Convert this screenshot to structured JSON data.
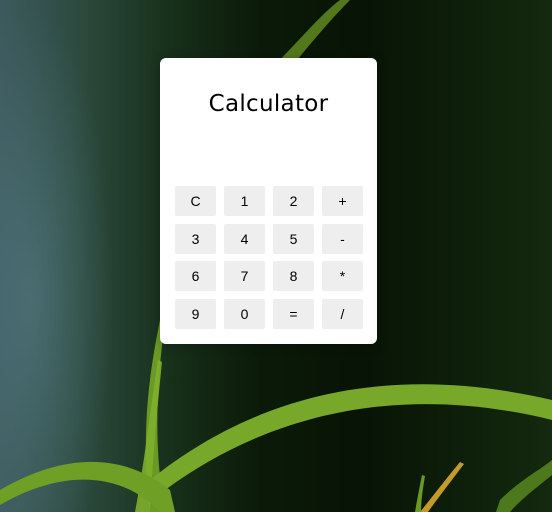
{
  "calculator": {
    "title": "Calculator",
    "display_value": "",
    "keys": [
      "C",
      "1",
      "2",
      "+",
      "3",
      "4",
      "5",
      "-",
      "6",
      "7",
      "8",
      "*",
      "9",
      "0",
      "=",
      "/"
    ]
  },
  "colors": {
    "card_background": "#ffffff",
    "key_background": "#eeeeee",
    "text": "#000000"
  }
}
